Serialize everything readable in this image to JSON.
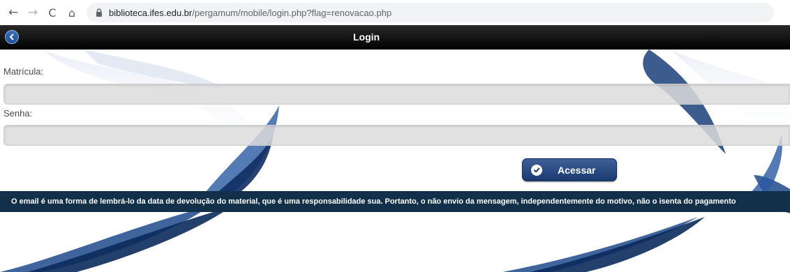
{
  "browser": {
    "url_domain": "biblioteca.ifes.edu.br",
    "url_path": "/pergamum/mobile/login.php?flag=renovacao.php",
    "icons": [
      "back-arrow-icon",
      "forward-arrow-icon",
      "reload-icon",
      "home-icon",
      "lock-icon"
    ]
  },
  "header": {
    "title": "Login",
    "back_icon": "chevron-left-icon"
  },
  "form": {
    "matricula_label": "Matrícula:",
    "matricula_value": "",
    "senha_label": "Senha:",
    "senha_value": "",
    "submit_label": "Acessar",
    "submit_icon": "check-icon"
  },
  "notice": {
    "text": "O email é uma forma de lembrá-lo da data de devolução do material, que é uma responsabilidade sua. Portanto, o não envio da mensagem, independentemente do motivo, não o isenta do pagamento"
  },
  "colors": {
    "header_bg": "#000000",
    "button_bg": "#2a4a82",
    "notice_bg": "#123049",
    "swirl": "#1e4a8c"
  }
}
